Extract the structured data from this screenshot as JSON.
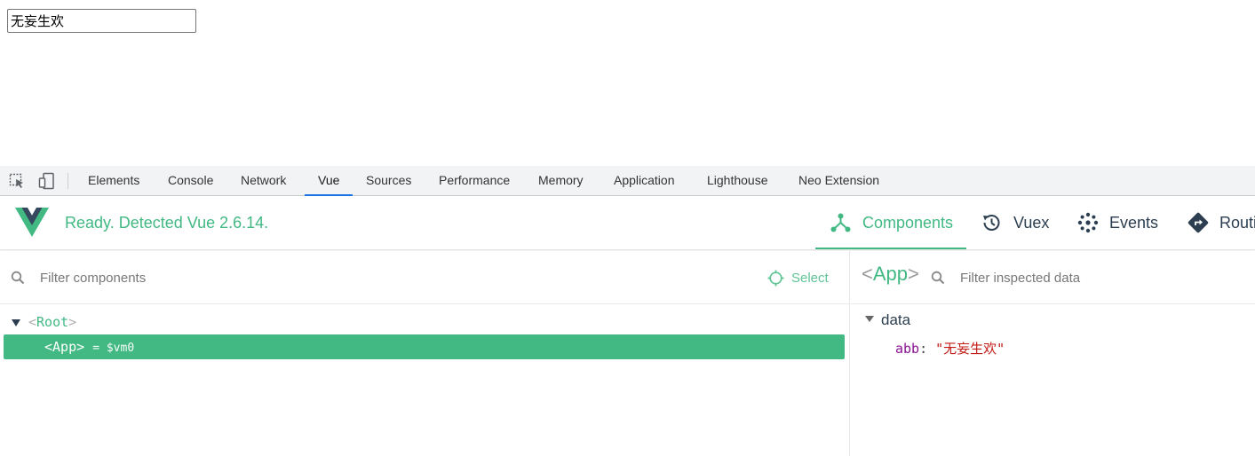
{
  "page": {
    "input_value": "无妄生欢"
  },
  "devtools": {
    "tabs": [
      {
        "label": "Elements"
      },
      {
        "label": "Console"
      },
      {
        "label": "Network"
      },
      {
        "label": "Vue"
      },
      {
        "label": "Sources"
      },
      {
        "label": "Performance"
      },
      {
        "label": "Memory"
      },
      {
        "label": "Application"
      },
      {
        "label": "Lighthouse"
      },
      {
        "label": "Neo Extension"
      }
    ],
    "active_tab": "Vue",
    "accent_color": "#1a73e8"
  },
  "vue": {
    "status": "Ready. Detected Vue 2.6.14.",
    "brand_color": "#42b983",
    "nav": [
      {
        "label": "Components",
        "icon": "components-icon",
        "active": true
      },
      {
        "label": "Vuex",
        "icon": "history-icon"
      },
      {
        "label": "Events",
        "icon": "events-icon"
      },
      {
        "label": "Routing",
        "icon": "routing-icon"
      }
    ],
    "components_pane": {
      "filter_placeholder": "Filter components",
      "select_label": "Select",
      "tree": {
        "root": {
          "lt": "<",
          "name": "Root",
          "gt": ">"
        },
        "app": {
          "lt": "<",
          "name": "App",
          "gt": ">",
          "vm": "= $vm0"
        }
      }
    },
    "inspector": {
      "component": {
        "lt": "<",
        "name": "App",
        "gt": ">"
      },
      "filter_placeholder": "Filter inspected data",
      "section": "data",
      "entries": [
        {
          "key": "abb",
          "colon": ":",
          "value": "\"无妄生欢\""
        }
      ]
    }
  }
}
